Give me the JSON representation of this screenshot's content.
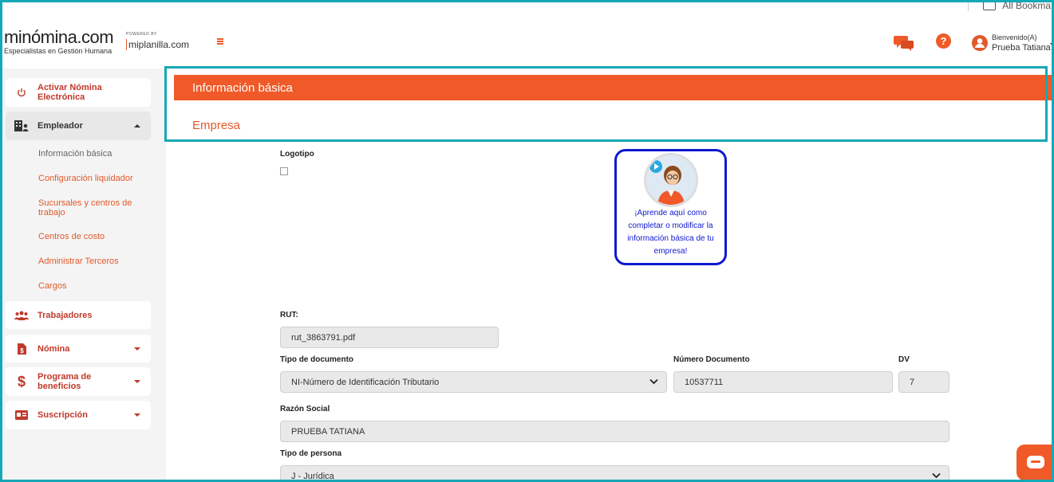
{
  "browser": {
    "bookmarks_label": "All Bookma"
  },
  "header": {
    "logo_text": "minómina.com",
    "logo_tagline": "Especialistas en Gestión Humana",
    "powered_by": "POWERED BY",
    "powered_brand": "miplanilla.com",
    "user_welcome": "Bienvenido(A)",
    "user_name": "Prueba Tatiana",
    "icons": [
      "chat-icon",
      "help-icon",
      "user-icon"
    ],
    "accent_color": "#f05a28"
  },
  "sidebar": {
    "items": [
      {
        "label": "Activar Nómina Electrónica",
        "icon": "power-icon"
      },
      {
        "label": "Empleador",
        "icon": "building-icon",
        "expanded": true
      },
      {
        "label": "Trabajadores",
        "icon": "users-icon"
      },
      {
        "label": "Nómina",
        "icon": "payroll-icon"
      },
      {
        "label": "Programa de beneficios",
        "icon": "dollar-icon"
      },
      {
        "label": "Suscripción",
        "icon": "card-icon"
      }
    ],
    "sub_items": [
      "Información básica",
      "Configuración liquidador",
      "Sucursales y centros de trabajo",
      "Centros de costo",
      "Administrar Terceros",
      "Cargos"
    ]
  },
  "main": {
    "banner_title": "Información básica",
    "section_title": "Empresa",
    "logo_label": "Logotipo",
    "help_card_text": "¡Aprende aquí como completar o modificar la información básica de tu empresa!",
    "rut_label": "RUT:",
    "rut_value": "rut_3863791.pdf",
    "doc_type_label": "Tipo de documento",
    "doc_type_value": "NI-Número de Identificación Tributario",
    "doc_number_label": "Número Documento",
    "doc_number_value": "10537711",
    "dv_label": "DV",
    "dv_value": "7",
    "business_name_label": "Razón Social",
    "business_name_value": "PRUEBA TATIANA",
    "person_type_label": "Tipo de persona",
    "person_type_value": "J - Jurídica"
  }
}
